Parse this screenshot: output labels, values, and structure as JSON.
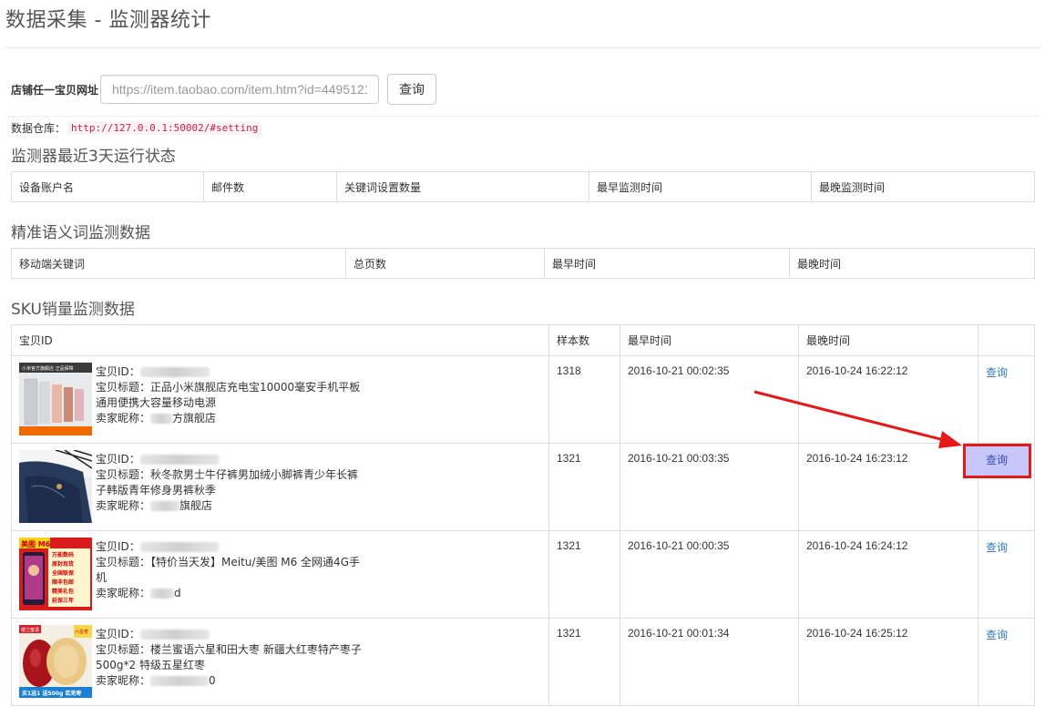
{
  "page": {
    "title": "数据采集 - 监测器统计"
  },
  "form": {
    "label": "店铺任一宝贝网址",
    "placeholder": "https://item.taobao.com/item.htm?id=4495121",
    "button": "查询"
  },
  "repo": {
    "label": "数据仓库：",
    "url": "http://127.0.0.1:50002/#setting"
  },
  "section1": {
    "title": "监测器最近3天运行状态",
    "headers": [
      "设备账户名",
      "邮件数",
      "关键词设置数量",
      "最早监测时间",
      "最晚监测时间"
    ]
  },
  "section2": {
    "title": "精准语义词监测数据",
    "headers": [
      "移动端关键词",
      "总页数",
      "最早时间",
      "最晚时间"
    ]
  },
  "section3": {
    "title": "SKU销量监测数据",
    "headers": [
      "宝贝ID",
      "样本数",
      "最早时间",
      "最晚时间",
      ""
    ],
    "id_label": "宝贝ID：",
    "title_label": "宝贝标题：",
    "seller_label": "卖家昵称：",
    "rows": [
      {
        "title": "正品小米旗舰店充电宝10000毫安手机平板通用便携大容量移动电源",
        "seller_suffix": "方旗舰店",
        "samples": "1318",
        "earliest": "2016-10-21 00:02:35",
        "latest": "2016-10-24 16:22:12",
        "action": "查询",
        "thumb": "powerbank"
      },
      {
        "title": "秋冬款男士牛仔裤男加绒小脚裤青少年长裤子韩版青年修身男裤秋季",
        "seller_suffix": "旗舰店",
        "samples": "1321",
        "earliest": "2016-10-21 00:03:35",
        "latest": "2016-10-24 16:23:12",
        "action": "查询",
        "thumb": "jeans"
      },
      {
        "title": "【特价当天发】Meitu/美图 M6 全网通4G手机",
        "seller_suffix": "d",
        "samples": "1321",
        "earliest": "2016-10-21 00:00:35",
        "latest": "2016-10-24 16:24:12",
        "action": "查询",
        "thumb": "phone"
      },
      {
        "title": "楼兰蜜语六星和田大枣 新疆大红枣特产枣子500g*2 特级五星红枣",
        "seller_suffix": "0",
        "samples": "1321",
        "earliest": "2016-10-21 00:01:34",
        "latest": "2016-10-24 16:25:12",
        "action": "查询",
        "thumb": "dates"
      }
    ]
  },
  "thumb_text": {
    "powerbank_banner": "小米官方旗舰店 正品保障",
    "phone_badge": "美图 M6",
    "phone_lines": [
      "万能数码",
      "原封现货",
      "全国联保",
      "顺丰包邮",
      "精美礼包",
      "延保三年"
    ],
    "dates_badge": "楼兰蜜语",
    "dates_tag": "六星枣",
    "dates_bottom": "买1送1 送500g 若羌枣"
  },
  "colors": {
    "highlight_border": "#e61818",
    "highlight_fill": "#c6c6f8",
    "link": "#337ab7",
    "arrow": "#e61818"
  }
}
